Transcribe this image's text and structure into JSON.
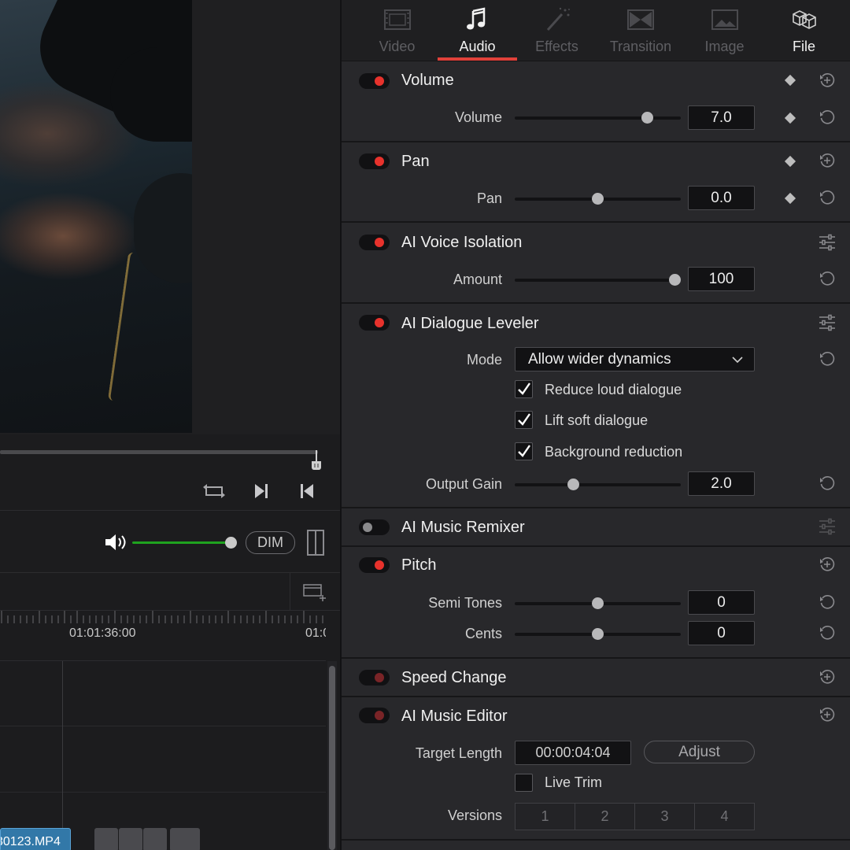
{
  "viewer": {
    "dim_label": "DIM"
  },
  "timeline": {
    "timecodes": [
      "01:01:36:00",
      "01:0"
    ],
    "clip_label": "30123.MP4"
  },
  "tabs": [
    {
      "label": "Video",
      "icon": "film-icon",
      "state": "disabled"
    },
    {
      "label": "Audio",
      "icon": "music-note-icon",
      "state": "active"
    },
    {
      "label": "Effects",
      "icon": "magic-wand-icon",
      "state": "disabled"
    },
    {
      "label": "Transition",
      "icon": "transition-icon",
      "state": "disabled"
    },
    {
      "label": "Image",
      "icon": "image-icon",
      "state": "disabled"
    },
    {
      "label": "File",
      "icon": "file-boxes-icon",
      "state": "enabled"
    }
  ],
  "sections": {
    "volume": {
      "title": "Volume",
      "enabled": true,
      "rows": [
        {
          "label": "Volume",
          "value": "7.0",
          "position": 0.82
        }
      ]
    },
    "pan": {
      "title": "Pan",
      "enabled": true,
      "rows": [
        {
          "label": "Pan",
          "value": "0.0",
          "position": 0.5
        }
      ]
    },
    "voice_isolation": {
      "title": "AI Voice Isolation",
      "enabled": true,
      "rows": [
        {
          "label": "Amount",
          "value": "100",
          "position": 1.0
        }
      ]
    },
    "dialogue_leveler": {
      "title": "AI Dialogue Leveler",
      "enabled": true,
      "mode_label": "Mode",
      "mode_value": "Allow wider dynamics",
      "checks": [
        {
          "label": "Reduce loud dialogue",
          "checked": true
        },
        {
          "label": "Lift soft dialogue",
          "checked": true
        },
        {
          "label": "Background reduction",
          "checked": true
        }
      ],
      "output_gain": {
        "label": "Output Gain",
        "value": "2.0",
        "position": 0.34
      }
    },
    "music_remixer": {
      "title": "AI Music Remixer",
      "enabled": false
    },
    "pitch": {
      "title": "Pitch",
      "enabled": true,
      "rows": [
        {
          "label": "Semi Tones",
          "value": "0",
          "position": 0.5
        },
        {
          "label": "Cents",
          "value": "0",
          "position": 0.5
        }
      ]
    },
    "speed_change": {
      "title": "Speed Change",
      "enabled": true
    },
    "music_editor": {
      "title": "AI Music Editor",
      "enabled": true,
      "target_length_label": "Target Length",
      "target_length_value": "00:00:04:04",
      "adjust_label": "Adjust",
      "live_trim_label": "Live Trim",
      "live_trim_checked": false,
      "versions_label": "Versions",
      "versions": [
        "1",
        "2",
        "3",
        "4"
      ]
    }
  },
  "colors": {
    "accent_red": "#e0413a",
    "toggle_on": "#e8322c",
    "volume_green": "#1fa31f",
    "clip_blue": "#3278a8"
  }
}
